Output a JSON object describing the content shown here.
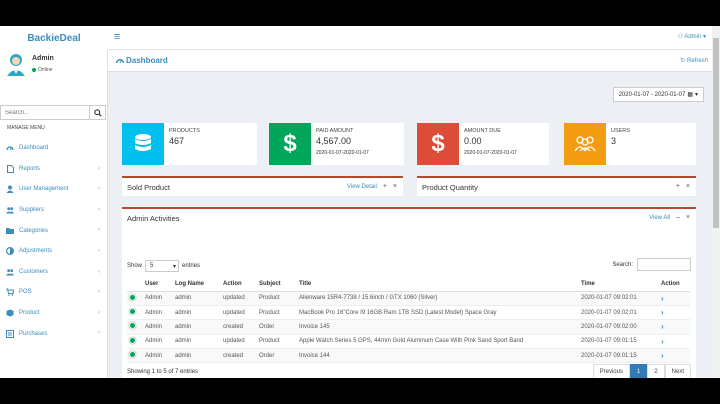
{
  "app": {
    "brand": "BackieDeal"
  },
  "topbar": {
    "admin_label": "Admin ▾"
  },
  "user": {
    "name": "Admin",
    "status": "Online"
  },
  "sidebar": {
    "search_placeholder": "Search...",
    "menu_header": "MANAGE MENU",
    "items": [
      {
        "label": "Dashboard",
        "chevron": ""
      },
      {
        "label": "Reports",
        "chevron": "‹"
      },
      {
        "label": "User Management",
        "chevron": "‹"
      },
      {
        "label": "Suppliers",
        "chevron": "‹"
      },
      {
        "label": "Categories",
        "chevron": "‹"
      },
      {
        "label": "Adjustments",
        "chevron": "‹"
      },
      {
        "label": "Customers",
        "chevron": "‹"
      },
      {
        "label": "POS",
        "chevron": "‹"
      },
      {
        "label": "Product",
        "chevron": "‹"
      },
      {
        "label": "Purchases",
        "chevron": "‹"
      }
    ]
  },
  "page": {
    "title": "Dashboard",
    "refresh": "Refresh"
  },
  "daterange": "2020-01-07 - 2020-01-07",
  "stats": [
    {
      "label": "PRODUCTS",
      "value": "467",
      "date": "",
      "color": "#00c0ef",
      "icon": "database-icon"
    },
    {
      "label": "PAID AMOUNT",
      "value": "4,567.00",
      "date": "2020-01-07-2020-01-07",
      "color": "#00a65a",
      "icon": "dollar-icon"
    },
    {
      "label": "AMOUNT DUE",
      "value": "0.00",
      "date": "2020-01-07-2020-01-07",
      "color": "#dd4b39",
      "icon": "dollar-icon"
    },
    {
      "label": "USERS",
      "value": "3",
      "date": "",
      "color": "#f39c12",
      "icon": "users-icon"
    }
  ],
  "panels": {
    "sold": {
      "title": "Sold Product",
      "view": "View Detail"
    },
    "qty": {
      "title": "Product Quantity"
    },
    "activities": {
      "title": "Admin Activities",
      "view": "View All"
    }
  },
  "table": {
    "show_label": "Show",
    "show_value": "5",
    "entries_label": "entries",
    "search_label": "Search:",
    "headers": [
      "",
      "User",
      "Log Name",
      "Action",
      "Subject",
      "Title",
      "Time",
      "Action"
    ],
    "rows": [
      [
        "Admin",
        "admin",
        "updated",
        "Product",
        "Alienware 15R4-7738 / 15.6inch / GTX 1060 (Silver)",
        "2020-01-07 09:02:01"
      ],
      [
        "Admin",
        "admin",
        "updated",
        "Product",
        "MacBook Pro 16\"Core I9 16GB Ram 1TB SSD (Latest Model) Space Gray",
        "2020-01-07 09:02:01"
      ],
      [
        "Admin",
        "admin",
        "created",
        "Order",
        "Invoice 145",
        "2020-01-07 09:02:00"
      ],
      [
        "Admin",
        "admin",
        "updated",
        "Product",
        "Apple Watch Series 5 GPS, 44mm Gold Aluminum Case With Pink Sand Sport Band",
        "2020-01-07 09:01:15"
      ],
      [
        "Admin",
        "admin",
        "created",
        "Order",
        "Invoice 144",
        "2020-01-07 09:01:15"
      ]
    ],
    "showing": "Showing 1 to 5 of 7 entries",
    "pager": [
      "Previous",
      "1",
      "2",
      "Next"
    ]
  }
}
